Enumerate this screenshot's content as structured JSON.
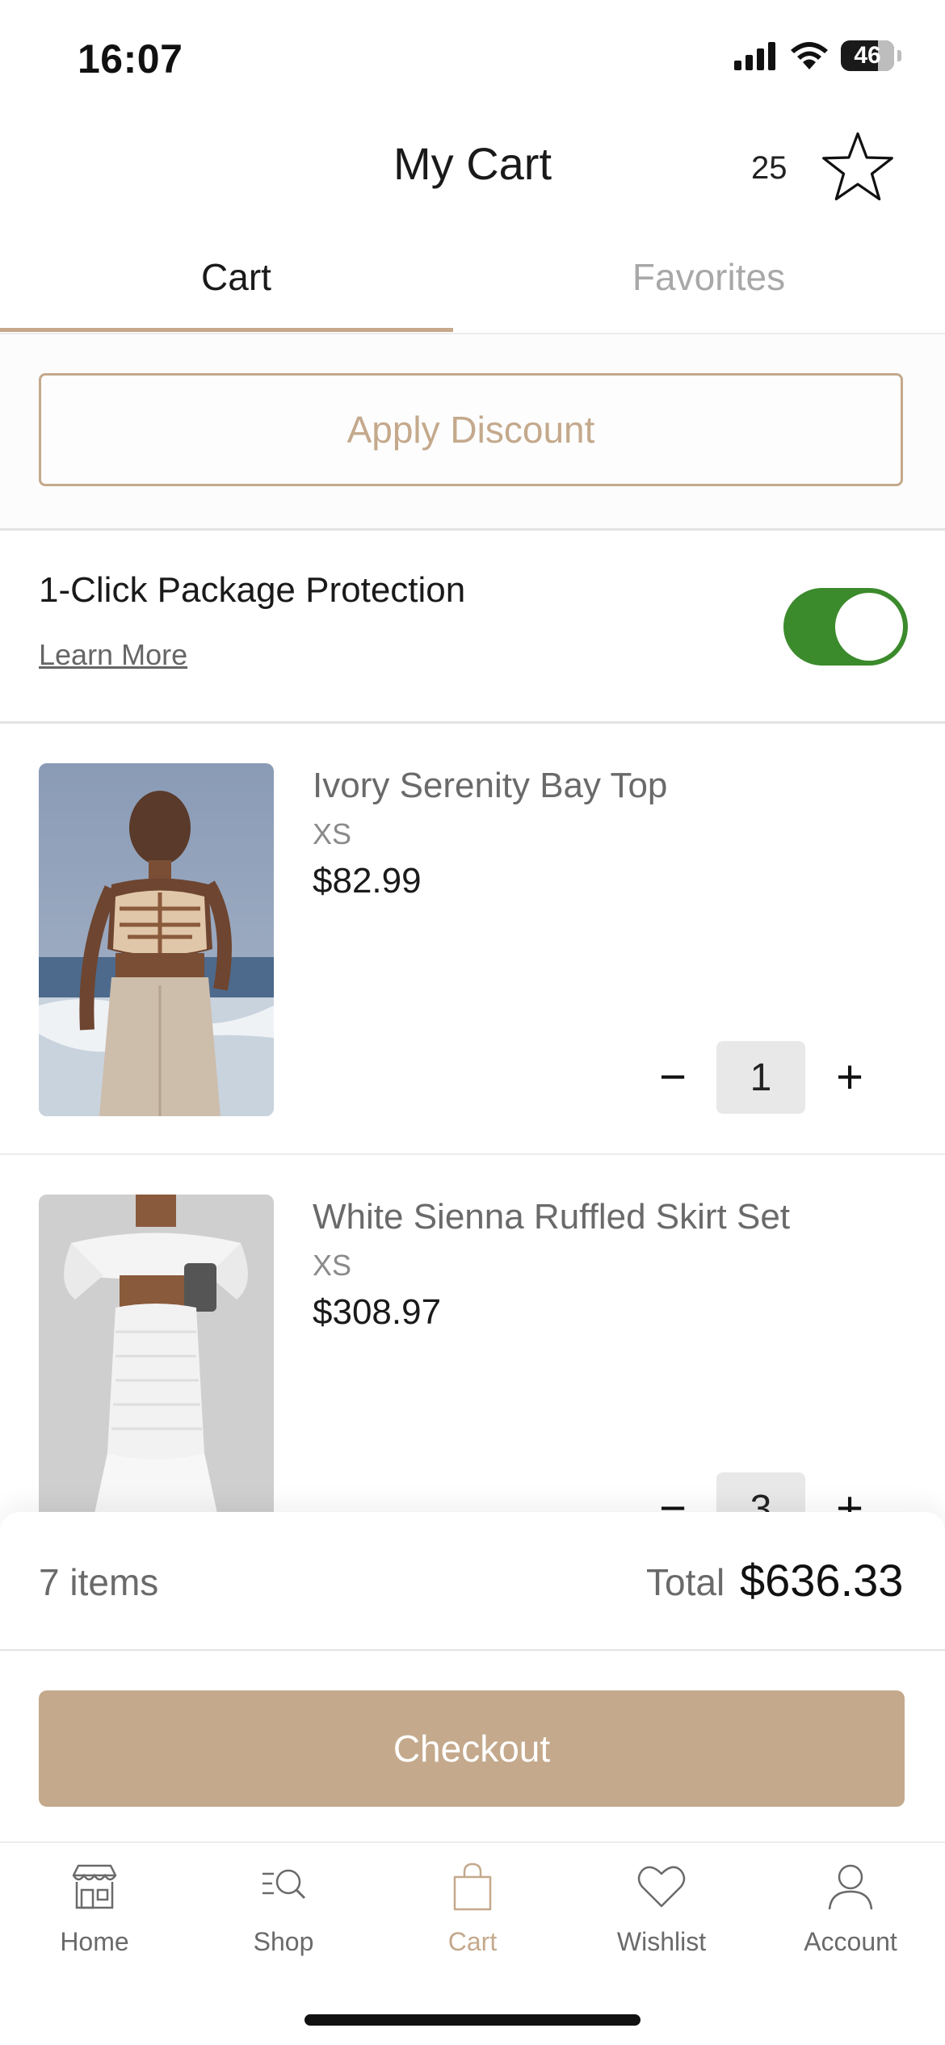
{
  "status_bar": {
    "time": "16:07",
    "battery": "46"
  },
  "header": {
    "title": "My Cart",
    "favorites_count": "25"
  },
  "tabs": [
    {
      "label": "Cart",
      "active": true
    },
    {
      "label": "Favorites",
      "active": false
    }
  ],
  "discount": {
    "label": "Apply Discount"
  },
  "protection": {
    "title": "1-Click Package Protection",
    "link": "Learn More",
    "enabled": true
  },
  "products": [
    {
      "name": "Ivory Serenity Bay Top",
      "size": "XS",
      "price": "$82.99",
      "qty": "1"
    },
    {
      "name": "White Sienna Ruffled Skirt Set",
      "size": "XS",
      "price": "$308.97",
      "qty": "3"
    }
  ],
  "summary": {
    "items": "7 items",
    "total_label": "Total",
    "total_value": "$636.33"
  },
  "checkout": {
    "label": "Checkout"
  },
  "nav": [
    {
      "label": "Home",
      "icon": "store-icon",
      "active": false
    },
    {
      "label": "Shop",
      "icon": "search-list-icon",
      "active": false
    },
    {
      "label": "Cart",
      "icon": "bag-icon",
      "active": true
    },
    {
      "label": "Wishlist",
      "icon": "heart-icon",
      "active": false
    },
    {
      "label": "Account",
      "icon": "user-icon",
      "active": false
    }
  ],
  "colors": {
    "accent": "#c4a98c",
    "toggle_on": "#3b8a2c"
  }
}
